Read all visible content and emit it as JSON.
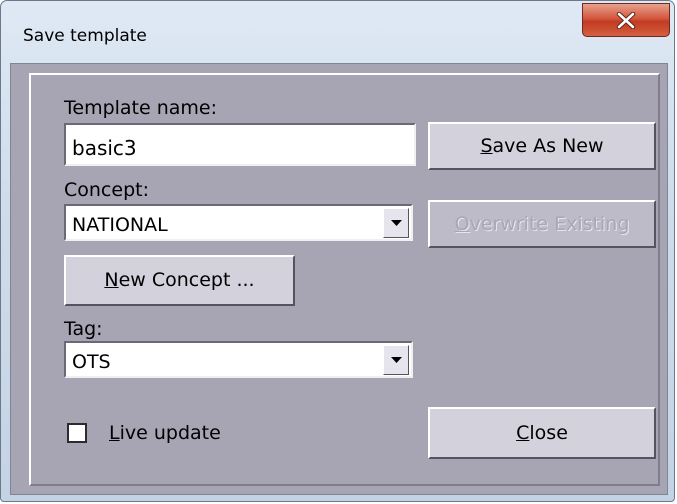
{
  "window": {
    "title": "Save template"
  },
  "icons": {
    "close": "close-x-icon",
    "dropdown": "chevron-down-icon"
  },
  "form": {
    "template_name_label": "Template name:",
    "template_name_value": "basic3",
    "concept_label": "Concept:",
    "concept_value": "NATIONAL",
    "tag_label": "Tag:",
    "tag_value": "OTS",
    "live_update_label_mnemonic": "L",
    "live_update_label_rest": "ive update",
    "live_update_checked": false
  },
  "buttons": {
    "save_as_new_mnemonic": "S",
    "save_as_new_rest": "ave As New",
    "overwrite_mnemonic": "O",
    "overwrite_rest": "verwrite Existing",
    "overwrite_enabled": false,
    "new_concept_mnemonic": "N",
    "new_concept_rest": "ew Concept ...",
    "close_mnemonic": "C",
    "close_rest": "lose"
  },
  "colors": {
    "dialog_background": "#a7a4b3",
    "close_button_red": "#c23b22",
    "title_bar": "#cfdceb"
  }
}
